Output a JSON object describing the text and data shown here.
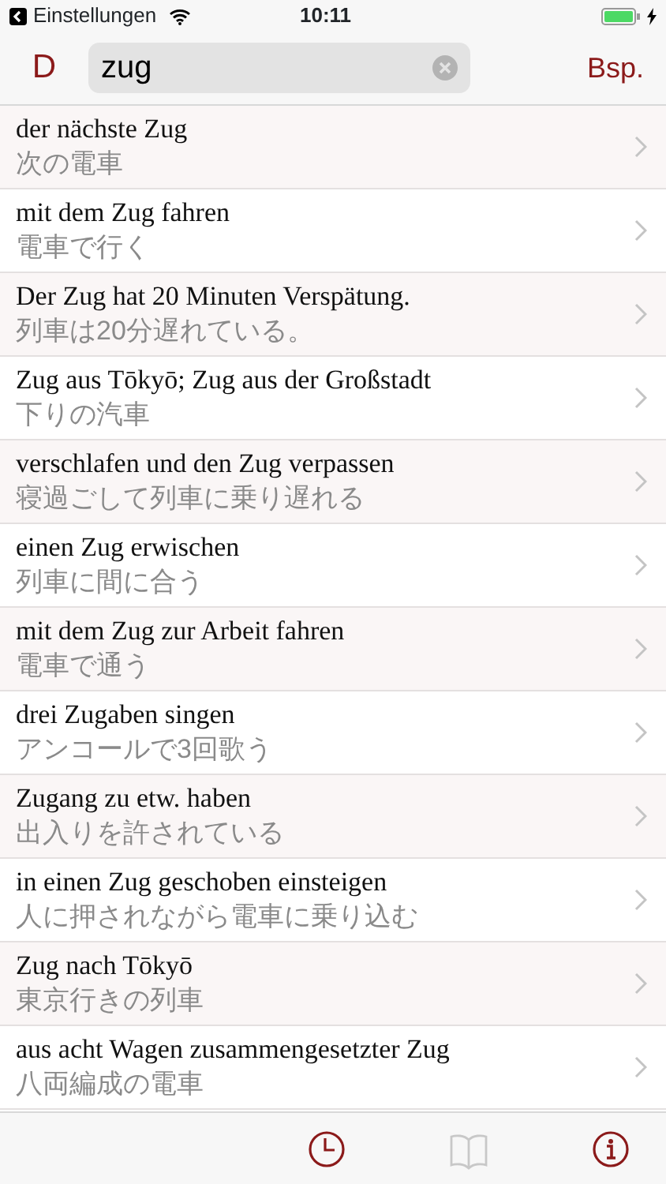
{
  "status_bar": {
    "back_label": "Einstellungen",
    "time": "10:11",
    "charging": true
  },
  "nav_bar": {
    "left_button": "D",
    "search": {
      "value": "zug"
    },
    "right_button": "Bsp."
  },
  "results": [
    {
      "german": "der nächste Zug",
      "japanese": "次の電車"
    },
    {
      "german": "mit dem Zug fahren",
      "japanese": "電車で行く"
    },
    {
      "german": "Der Zug hat 20 Minuten Verspätung.",
      "japanese": "列車は20分遅れている。"
    },
    {
      "german": "Zug aus Tōkyō; Zug aus der Großstadt",
      "japanese": "下りの汽車"
    },
    {
      "german": "verschlafen und den Zug verpassen",
      "japanese": "寝過ごして列車に乗り遅れる"
    },
    {
      "german": "einen Zug erwischen",
      "japanese": "列車に間に合う"
    },
    {
      "german": "mit dem Zug zur Arbeit fahren",
      "japanese": "電車で通う"
    },
    {
      "german": "drei Zugaben singen",
      "japanese": "アンコールで3回歌う"
    },
    {
      "german": "Zugang zu etw. haben",
      "japanese": "出入りを許されている"
    },
    {
      "german": "in einen Zug geschoben einsteigen",
      "japanese": "人に押されながら電車に乗り込む"
    },
    {
      "german": "Zug nach Tōkyō",
      "japanese": "東京行きの列車"
    },
    {
      "german": "aus acht Wagen zusammengesetzter Zug",
      "japanese": "八両編成の電車"
    }
  ],
  "toolbar": [
    {
      "kind": "history",
      "disabled": false
    },
    {
      "kind": "book",
      "disabled": true
    },
    {
      "kind": "info",
      "disabled": false
    }
  ]
}
